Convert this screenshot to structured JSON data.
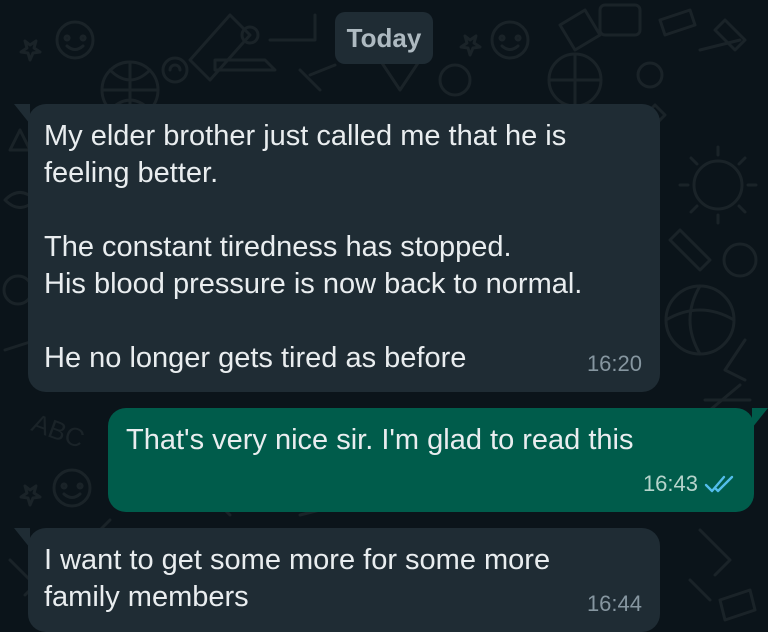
{
  "date_label": "Today",
  "messages": [
    {
      "direction": "incoming",
      "text": "My elder brother just called me that he is\nfeeling better.\n\nThe constant tiredness has stopped.\nHis blood pressure is now back to normal.\n\nHe no longer gets tired as before",
      "time": "16:20"
    },
    {
      "direction": "outgoing",
      "text": "That's very nice sir. I'm glad to read this",
      "time": "16:43",
      "status": "read",
      "status_icon": "double-check-icon"
    },
    {
      "direction": "incoming",
      "text": "I want to get some more for some more\nfamily members",
      "time": "16:44"
    }
  ],
  "colors": {
    "background": "#0b141a",
    "incoming_bubble": "#1f2c34",
    "outgoing_bubble": "#005c4b",
    "text": "#e9edef",
    "timestamp": "#8696a0",
    "read_ticks": "#53bdeb"
  }
}
